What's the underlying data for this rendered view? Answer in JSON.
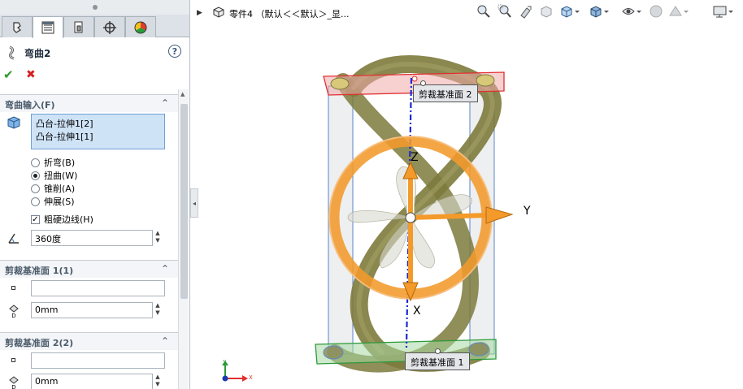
{
  "feature": {
    "title": "弯曲2",
    "help_label": "?",
    "ok_label": "✔",
    "cancel_label": "✖"
  },
  "tabs": [
    {
      "name": "feature-manager",
      "icon": "feature-tree-icon"
    },
    {
      "name": "property-manager",
      "icon": "property-list-icon"
    },
    {
      "name": "configuration-manager",
      "icon": "configuration-icon"
    },
    {
      "name": "dimxpert-manager",
      "icon": "crosshair-icon"
    },
    {
      "name": "display-manager",
      "icon": "color-wheel-icon"
    }
  ],
  "flex_input": {
    "header": "弯曲输入(F)",
    "bodies": [
      "凸台-拉伸1[2]",
      "凸台-拉伸1[1]"
    ],
    "options": [
      {
        "label": "折弯(B)",
        "selected": false
      },
      {
        "label": "扭曲(W)",
        "selected": true
      },
      {
        "label": "锥削(A)",
        "selected": false
      },
      {
        "label": "伸展(S)",
        "selected": false
      }
    ],
    "hard_edges": {
      "label": "粗硬边线(H)",
      "checked": true
    },
    "angle_value": "360度"
  },
  "trim_plane_1": {
    "header": "剪裁基准面 1(1)",
    "reference": "",
    "distance": "0mm"
  },
  "trim_plane_2": {
    "header": "剪裁基准面 2(2)",
    "reference": "",
    "distance": "0mm"
  },
  "viewport": {
    "part_label": "零件4 （默认＜＜默认＞_显...",
    "tags": {
      "plane2": "剪裁基准面 2",
      "plane1": "剪裁基准面 1"
    },
    "axes": {
      "z": "Z",
      "y": "Y",
      "x": "X"
    },
    "triad": {
      "y": "Y",
      "x": "X"
    },
    "colors": {
      "ribbon": "#7d7a3c",
      "manipulator": "#f39a2b",
      "plane2": "#e03030",
      "plane1": "#2a9a3a",
      "axis_blue": "#1a2ad0"
    }
  },
  "toolbar_icons": [
    "zoom-to-fit-icon",
    "zoom-to-area-icon",
    "previous-view-icon",
    "section-view-icon",
    "view-orientation-icon",
    "display-style-icon",
    "hide-show-items-icon",
    "edit-appearance-icon",
    "apply-scene-icon",
    "view-settings-icon"
  ]
}
